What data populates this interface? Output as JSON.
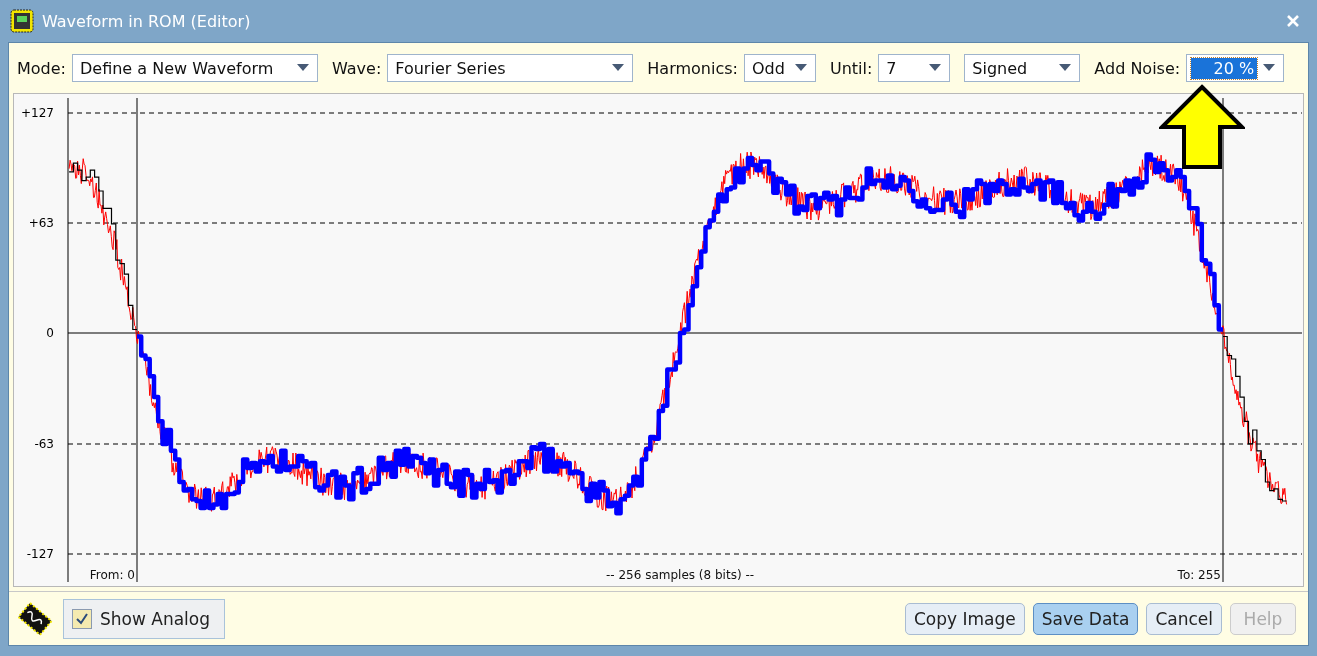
{
  "window": {
    "title": "Waveform in ROM (Editor)"
  },
  "toolbar": [
    {
      "label": "Mode:",
      "value": "Define a New Waveform",
      "highlighted": false,
      "kind": "wide"
    },
    {
      "label": "Wave:",
      "value": "Fourier Series",
      "highlighted": false,
      "kind": "wide"
    },
    {
      "label": "Harmonics:",
      "value": "Odd",
      "highlighted": false,
      "kind": "small"
    },
    {
      "label": "Until:",
      "value": "7",
      "highlighted": false,
      "kind": "small"
    },
    {
      "value": "Signed",
      "highlighted": false,
      "kind": "medium"
    },
    {
      "label": "Add Noise:",
      "value": "20 %",
      "highlighted": true,
      "kind": "small"
    }
  ],
  "chart": {
    "y_labels": [
      "+127",
      "+63",
      "0",
      "-63",
      "-127"
    ],
    "from_label": "From: 0",
    "caption": "-- 256 samples (8 bits) --",
    "to_label": "To: 255"
  },
  "show_analog": {
    "label": "Show Analog",
    "checked": true
  },
  "buttons": [
    {
      "label": "Copy Image",
      "default": false,
      "disabled": false
    },
    {
      "label": "Save Data",
      "default": true,
      "disabled": false
    },
    {
      "label": "Cancel",
      "default": false,
      "disabled": false
    },
    {
      "label": "Help",
      "default": false,
      "disabled": true
    }
  ]
}
